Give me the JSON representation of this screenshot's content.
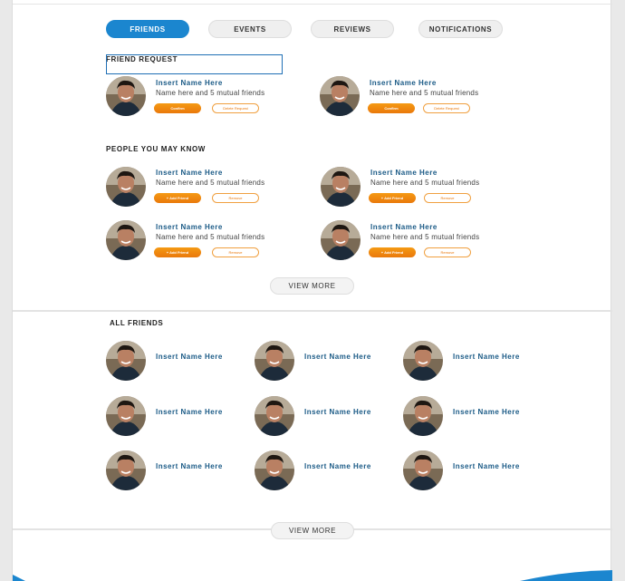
{
  "tabs": [
    {
      "label": "FRIENDS",
      "active": true
    },
    {
      "label": "EVENTS",
      "active": false
    },
    {
      "label": "REVIEWS",
      "active": false
    },
    {
      "label": "NOTIFICATIONS",
      "active": false
    }
  ],
  "friend_request": {
    "title": "FRIEND REQUEST",
    "items": [
      {
        "name": "Insert Name Here",
        "meta": "Name here and 5 mutual friends",
        "confirm": "Confirm",
        "delete": "Delete Request"
      },
      {
        "name": "Insert Name Here",
        "meta": "Name here and 5 mutual friends",
        "confirm": "Confirm",
        "delete": "Delete Request"
      }
    ]
  },
  "people_you_may_know": {
    "title": "PEOPLE YOU MAY KNOW",
    "items": [
      {
        "name": "Insert Name Here",
        "meta": "Name here and 5 mutual friends",
        "add": "+ Add Friend",
        "remove": "Remove"
      },
      {
        "name": "Insert Name Here",
        "meta": "Name here and 5 mutual friends",
        "add": "+ Add Friend",
        "remove": "Remove"
      },
      {
        "name": "Insert Name Here",
        "meta": "Name here and 5 mutual friends",
        "add": "+ Add Friend",
        "remove": "Remove"
      },
      {
        "name": "Insert Name Here",
        "meta": "Name here and 5 mutual friends",
        "add": "+ Add Friend",
        "remove": "Remove"
      }
    ],
    "view_more": "VIEW MORE"
  },
  "all_friends": {
    "title": "ALL FRIENDS",
    "items": [
      {
        "name": "Insert Name Here"
      },
      {
        "name": "Insert Name Here"
      },
      {
        "name": "Insert Name Here"
      },
      {
        "name": "Insert Name Here"
      },
      {
        "name": "Insert Name Here"
      },
      {
        "name": "Insert Name Here"
      },
      {
        "name": "Insert Name Here"
      },
      {
        "name": "Insert Name Here"
      },
      {
        "name": "Insert Name Here"
      }
    ],
    "view_more": "VIEW MORE"
  },
  "colors": {
    "accent_blue": "#1b86cf",
    "accent_orange": "#f08a0e",
    "name_blue": "#1a5a86"
  }
}
